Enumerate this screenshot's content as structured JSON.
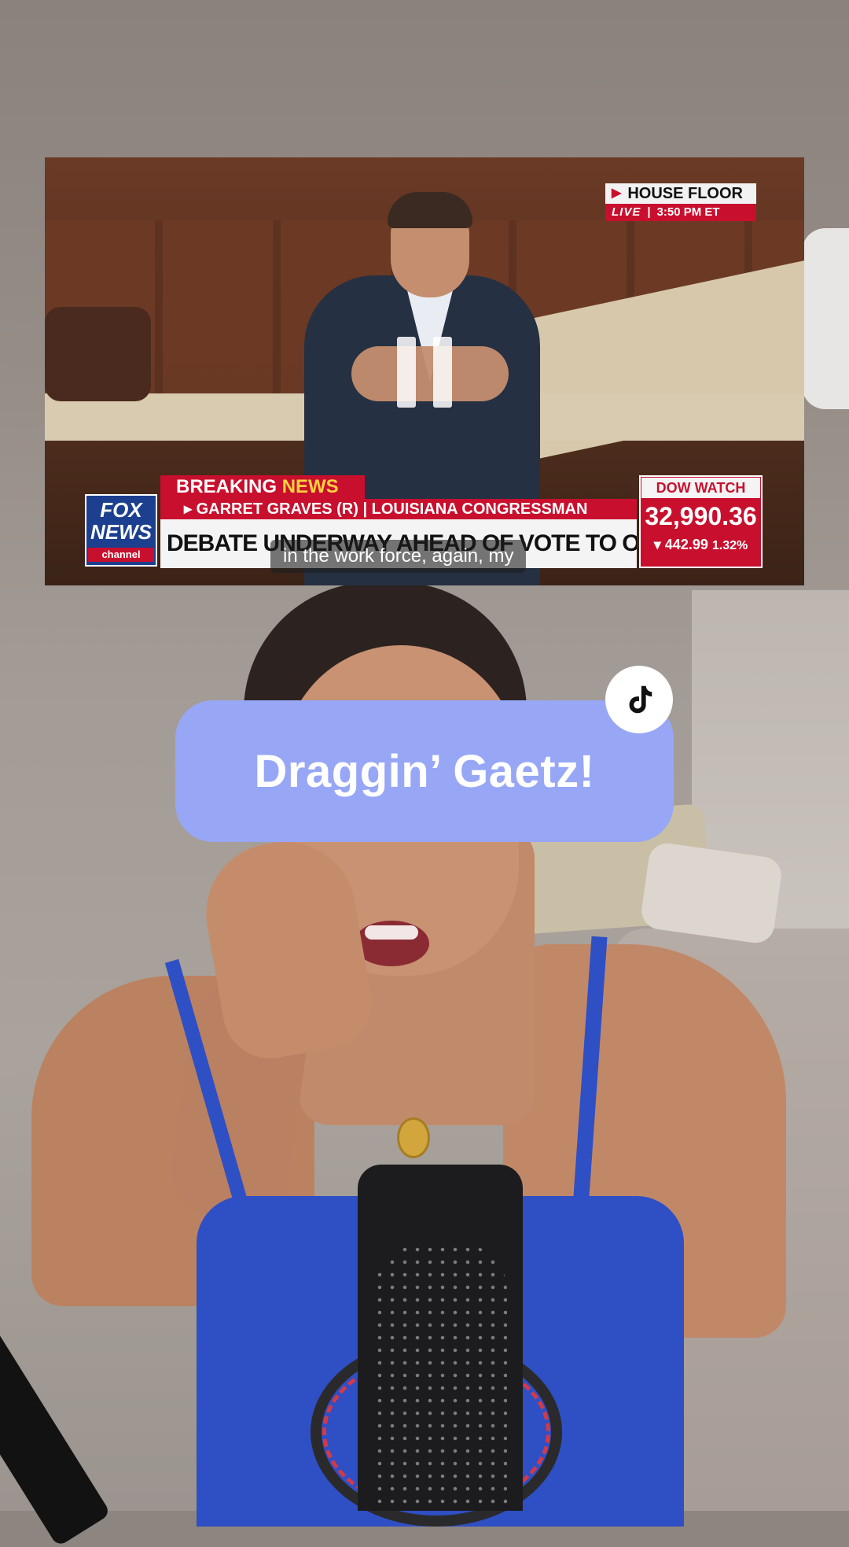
{
  "clip": {
    "house_floor": "HOUSE FLOOR",
    "live": "LIVE",
    "time": "3:50 PM ET",
    "network_logo_line1": "FOX",
    "network_logo_line2": "NEWS",
    "network_logo_line3": "channel",
    "breaking_1": "BREAKING",
    "breaking_2": "NEWS",
    "name_bar": "▸ GARRET GRAVES (R) | LOUISIANA CONGRESSMAN",
    "headline": "DEBATE UNDERWAY AHEAD OF VOTE TO OUST MCCARTHY",
    "dow_title": "DOW WATCH",
    "dow_value": "32,990.36",
    "dow_change": "442.99",
    "dow_pct": "1.32%",
    "caption": "in the work force, again, my"
  },
  "overlay": {
    "title": "Draggin’ Gaetz!"
  },
  "colors": {
    "pill": "#97a7f5",
    "fox_red": "#c8102e",
    "fox_blue": "#1c3f8f"
  },
  "icons": {
    "pause": "pause-icon",
    "tiktok": "tiktok-icon"
  }
}
